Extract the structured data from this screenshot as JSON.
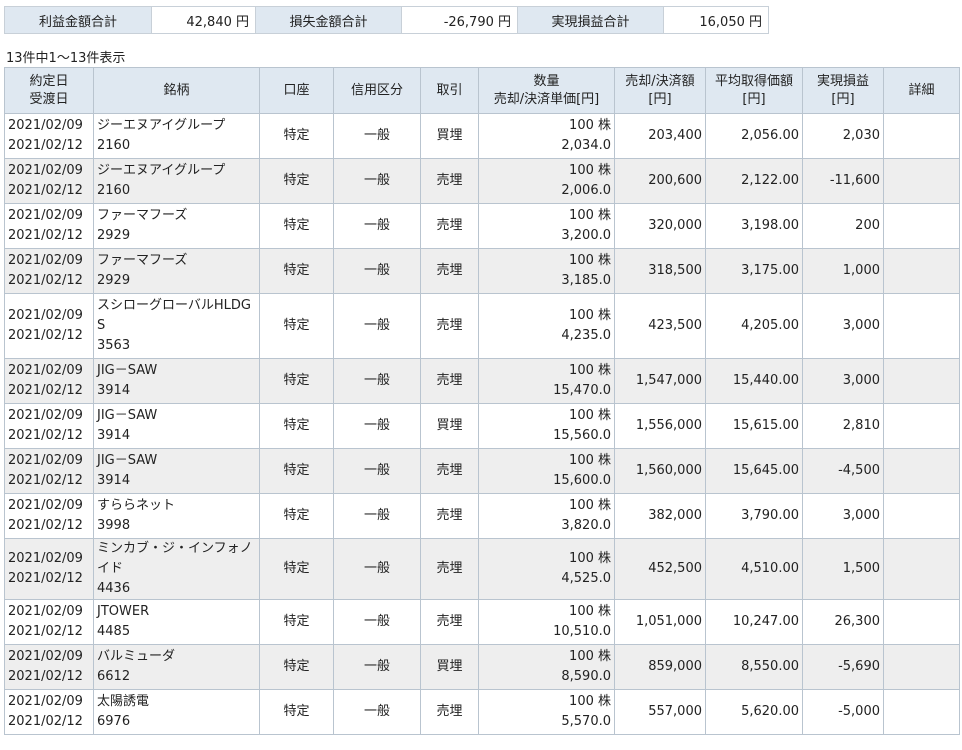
{
  "summary": {
    "profit_label": "利益金額合計",
    "profit_value": "42,840 円",
    "loss_label": "損失金額合計",
    "loss_value": "-26,790 円",
    "realized_label": "実現損益合計",
    "realized_value": "16,050 円"
  },
  "count_text": "13件中1～13件表示",
  "headers": {
    "date_a": "約定日",
    "date_b": "受渡日",
    "stock": "銘柄",
    "account": "口座",
    "credit": "信用区分",
    "trade": "取引",
    "qty_a": "数量",
    "qty_b": "売却/決済単価[円]",
    "amount_a": "売却/決済額",
    "amount_b": "[円]",
    "avg_a": "平均取得価額",
    "avg_b": "[円]",
    "pl_a": "実現損益",
    "pl_b": "[円]",
    "detail": "詳細"
  },
  "rows": [
    {
      "trade_date": "2021/02/09",
      "settle_date": "2021/02/12",
      "name": "ジーエヌアイグループ",
      "code": "2160",
      "account": "特定",
      "credit": "一般",
      "trade": "買埋",
      "qty": "100 株",
      "price": "2,034.0",
      "amount": "203,400",
      "avg_cost": "2,056.00",
      "pl": "2,030"
    },
    {
      "trade_date": "2021/02/09",
      "settle_date": "2021/02/12",
      "name": "ジーエヌアイグループ",
      "code": "2160",
      "account": "特定",
      "credit": "一般",
      "trade": "売埋",
      "qty": "100 株",
      "price": "2,006.0",
      "amount": "200,600",
      "avg_cost": "2,122.00",
      "pl": "-11,600"
    },
    {
      "trade_date": "2021/02/09",
      "settle_date": "2021/02/12",
      "name": "ファーマフーズ",
      "code": "2929",
      "account": "特定",
      "credit": "一般",
      "trade": "売埋",
      "qty": "100 株",
      "price": "3,200.0",
      "amount": "320,000",
      "avg_cost": "3,198.00",
      "pl": "200"
    },
    {
      "trade_date": "2021/02/09",
      "settle_date": "2021/02/12",
      "name": "ファーマフーズ",
      "code": "2929",
      "account": "特定",
      "credit": "一般",
      "trade": "売埋",
      "qty": "100 株",
      "price": "3,185.0",
      "amount": "318,500",
      "avg_cost": "3,175.00",
      "pl": "1,000"
    },
    {
      "trade_date": "2021/02/09",
      "settle_date": "2021/02/12",
      "name": "スシローグローバルHLDGS",
      "code": "3563",
      "account": "特定",
      "credit": "一般",
      "trade": "売埋",
      "qty": "100 株",
      "price": "4,235.0",
      "amount": "423,500",
      "avg_cost": "4,205.00",
      "pl": "3,000"
    },
    {
      "trade_date": "2021/02/09",
      "settle_date": "2021/02/12",
      "name": "JIG－SAW",
      "code": "3914",
      "account": "特定",
      "credit": "一般",
      "trade": "売埋",
      "qty": "100 株",
      "price": "15,470.0",
      "amount": "1,547,000",
      "avg_cost": "15,440.00",
      "pl": "3,000"
    },
    {
      "trade_date": "2021/02/09",
      "settle_date": "2021/02/12",
      "name": "JIG－SAW",
      "code": "3914",
      "account": "特定",
      "credit": "一般",
      "trade": "買埋",
      "qty": "100 株",
      "price": "15,560.0",
      "amount": "1,556,000",
      "avg_cost": "15,615.00",
      "pl": "2,810"
    },
    {
      "trade_date": "2021/02/09",
      "settle_date": "2021/02/12",
      "name": "JIG－SAW",
      "code": "3914",
      "account": "特定",
      "credit": "一般",
      "trade": "売埋",
      "qty": "100 株",
      "price": "15,600.0",
      "amount": "1,560,000",
      "avg_cost": "15,645.00",
      "pl": "-4,500"
    },
    {
      "trade_date": "2021/02/09",
      "settle_date": "2021/02/12",
      "name": "すららネット",
      "code": "3998",
      "account": "特定",
      "credit": "一般",
      "trade": "売埋",
      "qty": "100 株",
      "price": "3,820.0",
      "amount": "382,000",
      "avg_cost": "3,790.00",
      "pl": "3,000"
    },
    {
      "trade_date": "2021/02/09",
      "settle_date": "2021/02/12",
      "name": "ミンカブ・ジ・インフォノイド",
      "code": "4436",
      "account": "特定",
      "credit": "一般",
      "trade": "売埋",
      "qty": "100 株",
      "price": "4,525.0",
      "amount": "452,500",
      "avg_cost": "4,510.00",
      "pl": "1,500"
    },
    {
      "trade_date": "2021/02/09",
      "settle_date": "2021/02/12",
      "name": "JTOWER",
      "code": "4485",
      "account": "特定",
      "credit": "一般",
      "trade": "売埋",
      "qty": "100 株",
      "price": "10,510.0",
      "amount": "1,051,000",
      "avg_cost": "10,247.00",
      "pl": "26,300"
    },
    {
      "trade_date": "2021/02/09",
      "settle_date": "2021/02/12",
      "name": "バルミューダ",
      "code": "6612",
      "account": "特定",
      "credit": "一般",
      "trade": "買埋",
      "qty": "100 株",
      "price": "8,590.0",
      "amount": "859,000",
      "avg_cost": "8,550.00",
      "pl": "-5,690"
    },
    {
      "trade_date": "2021/02/09",
      "settle_date": "2021/02/12",
      "name": "太陽誘電",
      "code": "6976",
      "account": "特定",
      "credit": "一般",
      "trade": "売埋",
      "qty": "100 株",
      "price": "5,570.0",
      "amount": "557,000",
      "avg_cost": "5,620.00",
      "pl": "-5,000"
    }
  ]
}
